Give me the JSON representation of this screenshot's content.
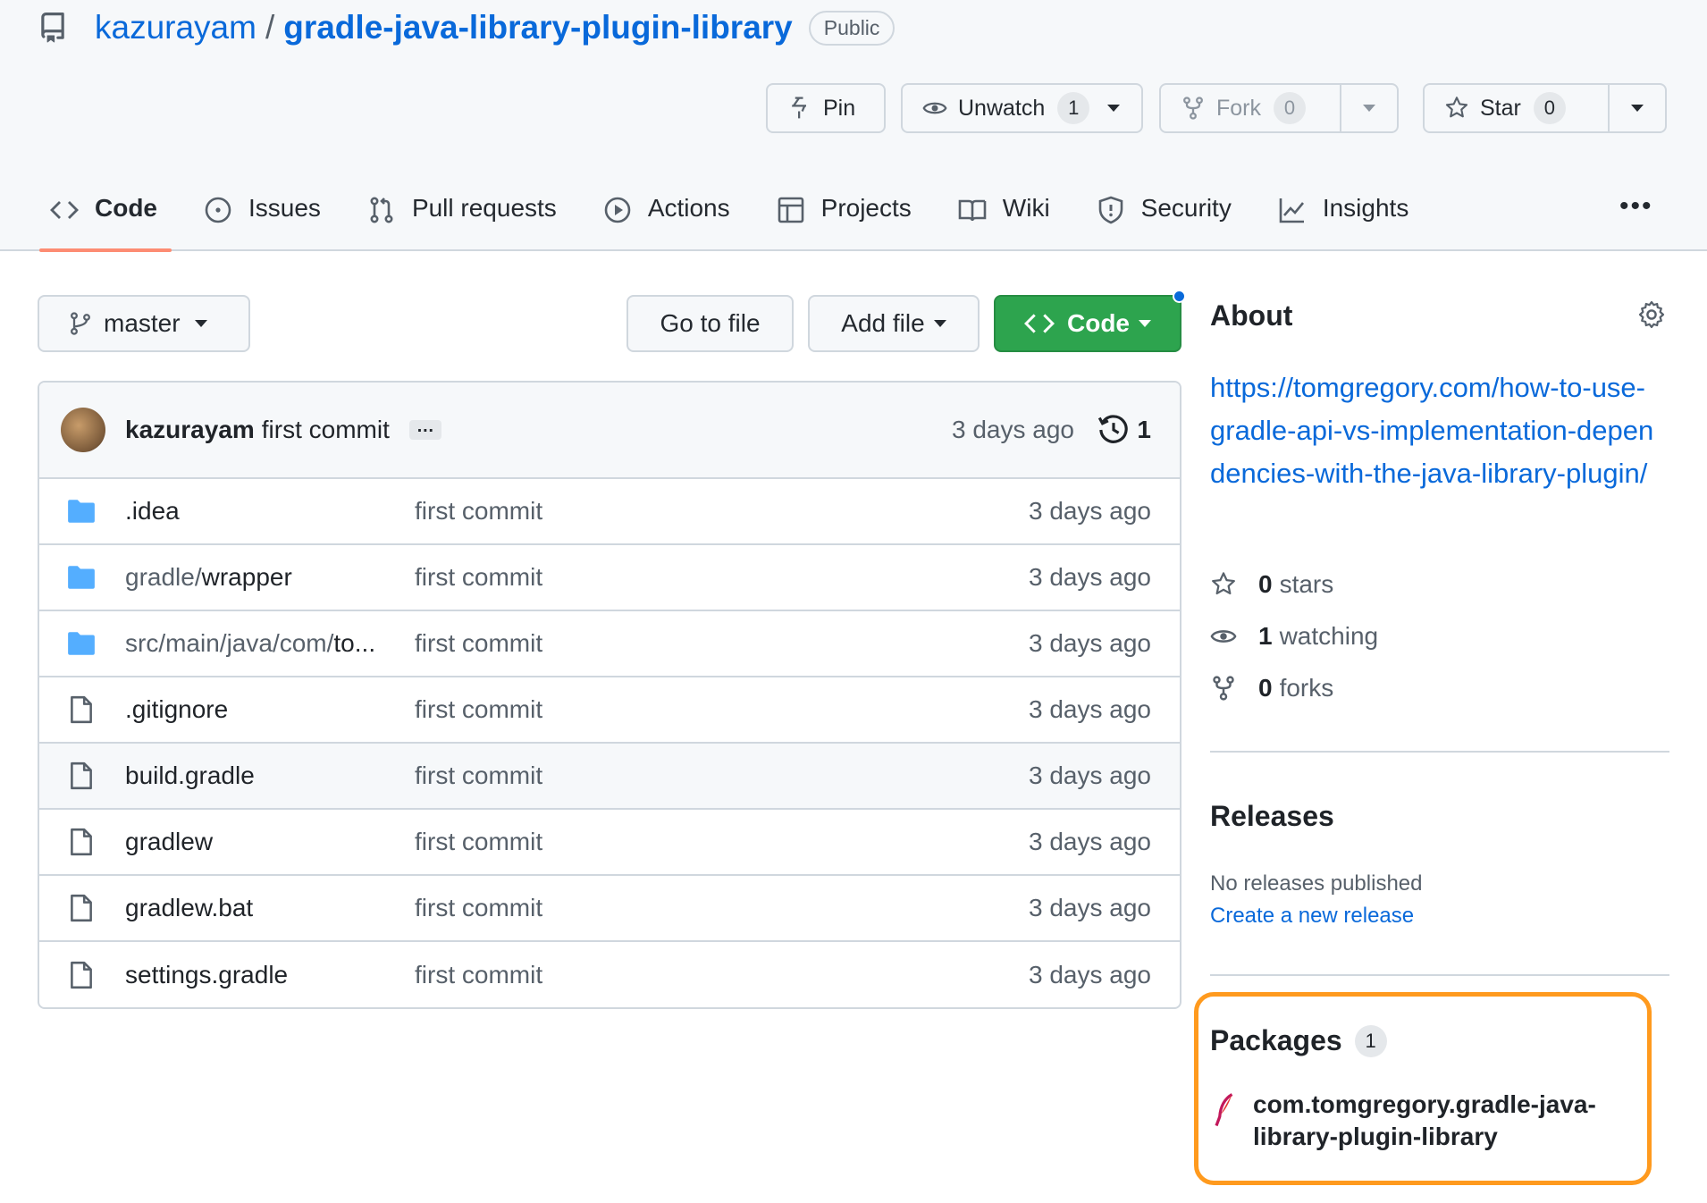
{
  "repo": {
    "owner": "kazurayam",
    "separator": "/",
    "name": "gradle-java-library-plugin-library",
    "visibility": "Public"
  },
  "actions": {
    "pin_label": "Pin",
    "unwatch_label": "Unwatch",
    "watch_count": "1",
    "fork_label": "Fork",
    "fork_count": "0",
    "star_label": "Star",
    "star_count": "0"
  },
  "tabs": [
    {
      "label": "Code",
      "icon": "code-icon",
      "active": true
    },
    {
      "label": "Issues",
      "icon": "issue-icon"
    },
    {
      "label": "Pull requests",
      "icon": "pull-request-icon"
    },
    {
      "label": "Actions",
      "icon": "play-icon"
    },
    {
      "label": "Projects",
      "icon": "table-icon"
    },
    {
      "label": "Wiki",
      "icon": "book-icon"
    },
    {
      "label": "Security",
      "icon": "shield-icon"
    },
    {
      "label": "Insights",
      "icon": "graph-icon"
    }
  ],
  "toolbar": {
    "branch": "master",
    "goto_file": "Go to file",
    "add_file": "Add file",
    "code": "Code"
  },
  "commit": {
    "author": "kazurayam",
    "message": "first commit",
    "ellipsis": "…",
    "time": "3 days ago",
    "count": "1"
  },
  "files": [
    {
      "type": "folder",
      "prefix": "",
      "name": ".idea",
      "message": "first commit",
      "time": "3 days ago"
    },
    {
      "type": "folder",
      "prefix": "gradle/",
      "name": "wrapper",
      "message": "first commit",
      "time": "3 days ago"
    },
    {
      "type": "folder",
      "prefix": "src/main/java/com/",
      "name": "to...",
      "message": "first commit",
      "time": "3 days ago"
    },
    {
      "type": "file",
      "prefix": "",
      "name": ".gitignore",
      "message": "first commit",
      "time": "3 days ago"
    },
    {
      "type": "file",
      "prefix": "",
      "name": "build.gradle",
      "message": "first commit",
      "time": "3 days ago"
    },
    {
      "type": "file",
      "prefix": "",
      "name": "gradlew",
      "message": "first commit",
      "time": "3 days ago"
    },
    {
      "type": "file",
      "prefix": "",
      "name": "gradlew.bat",
      "message": "first commit",
      "time": "3 days ago"
    },
    {
      "type": "file",
      "prefix": "",
      "name": "settings.gradle",
      "message": "first commit",
      "time": "3 days ago"
    }
  ],
  "about": {
    "title": "About",
    "link": "https://tomgregory.com/how-to-use-gradle-api-vs-implementation-dependencies-with-the-java-library-plugin/",
    "stars_count": "0",
    "stars_label": "stars",
    "watching_count": "1",
    "watching_label": "watching",
    "forks_count": "0",
    "forks_label": "forks"
  },
  "releases": {
    "title": "Releases",
    "none_text": "No releases published",
    "create_link": "Create a new release"
  },
  "packages": {
    "title": "Packages",
    "count": "1",
    "item": "com.tomgregory.gradle-java-library-plugin-library"
  },
  "colors": {
    "link": "#0969da",
    "primary_button": "#2da44e",
    "active_tab_underline": "#fd8c73",
    "highlight": "#ff9a1e",
    "folder": "#54aeff"
  }
}
